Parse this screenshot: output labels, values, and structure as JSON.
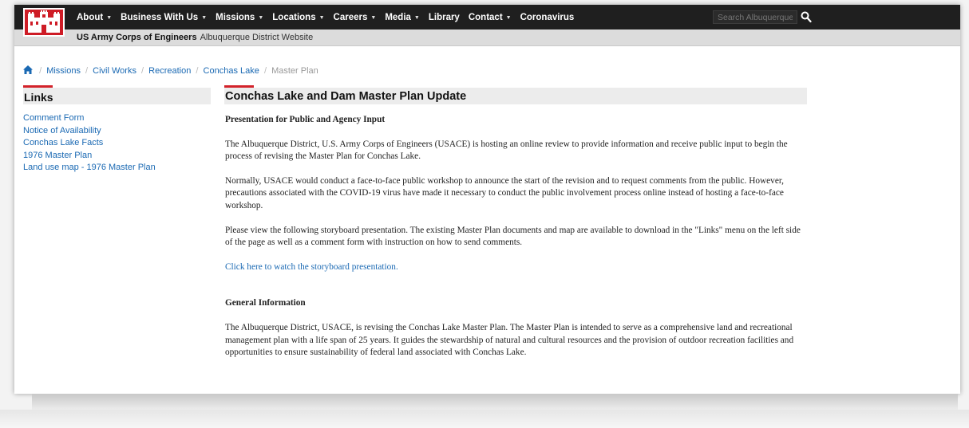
{
  "nav": {
    "items": [
      {
        "label": "About",
        "dropdown": true
      },
      {
        "label": "Business With Us",
        "dropdown": true
      },
      {
        "label": "Missions",
        "dropdown": true
      },
      {
        "label": "Locations",
        "dropdown": true
      },
      {
        "label": "Careers",
        "dropdown": true
      },
      {
        "label": "Media",
        "dropdown": true
      },
      {
        "label": "Library",
        "dropdown": false
      },
      {
        "label": "Contact",
        "dropdown": true
      },
      {
        "label": "Coronavirus",
        "dropdown": false
      }
    ],
    "search_placeholder": "Search Albuquerque",
    "caret": "▼"
  },
  "subbar": {
    "org": "US Army Corps of Engineers",
    "site": "Albuquerque District Website"
  },
  "breadcrumb": {
    "items": [
      "Missions",
      "Civil Works",
      "Recreation",
      "Conchas Lake"
    ],
    "current": "Master Plan",
    "separator": "/"
  },
  "sidebar": {
    "title": "Links",
    "links": [
      "Comment Form",
      "Notice of Availability",
      "Conchas Lake Facts",
      "1976 Master Plan",
      "Land use map - 1976 Master Plan"
    ]
  },
  "main": {
    "title": "Conchas Lake and Dam Master Plan Update",
    "subhead": "Presentation for Public and Agency Input",
    "para1": "The Albuquerque District, U.S. Army Corps of Engineers (USACE) is hosting an online review to provide information and receive public input to begin the process of revising the Master Plan for Conchas Lake.",
    "para2": "Normally, USACE would conduct a face-to-face public workshop to announce the start of the revision and to request comments from the public. However, precautions associated with the COVID-19 virus have made it necessary to conduct the public involvement process online instead of hosting a face-to-face workshop.",
    "para3": "Please view the following storyboard presentation. The existing Master Plan documents and map are available to download in the \"Links\" menu on the left side of the page as well as a comment form with instruction on how to send comments.",
    "link": "Click here to watch the storyboard presentation.",
    "general_head": "General Information",
    "para4": "The Albuquerque District, USACE, is revising the Conchas Lake Master Plan. The Master Plan is intended to serve as a comprehensive land and recreational management plan with a life span of 25 years. It guides the stewardship of natural and cultural resources and the provision of outdoor recreation facilities and opportunities to ensure sustainability of federal land associated with Conchas Lake."
  },
  "colors": {
    "brand_red": "#ce1c26",
    "accent_red": "#d3222a",
    "nav_bg": "#1f1f1f",
    "link": "#1a69b3"
  }
}
